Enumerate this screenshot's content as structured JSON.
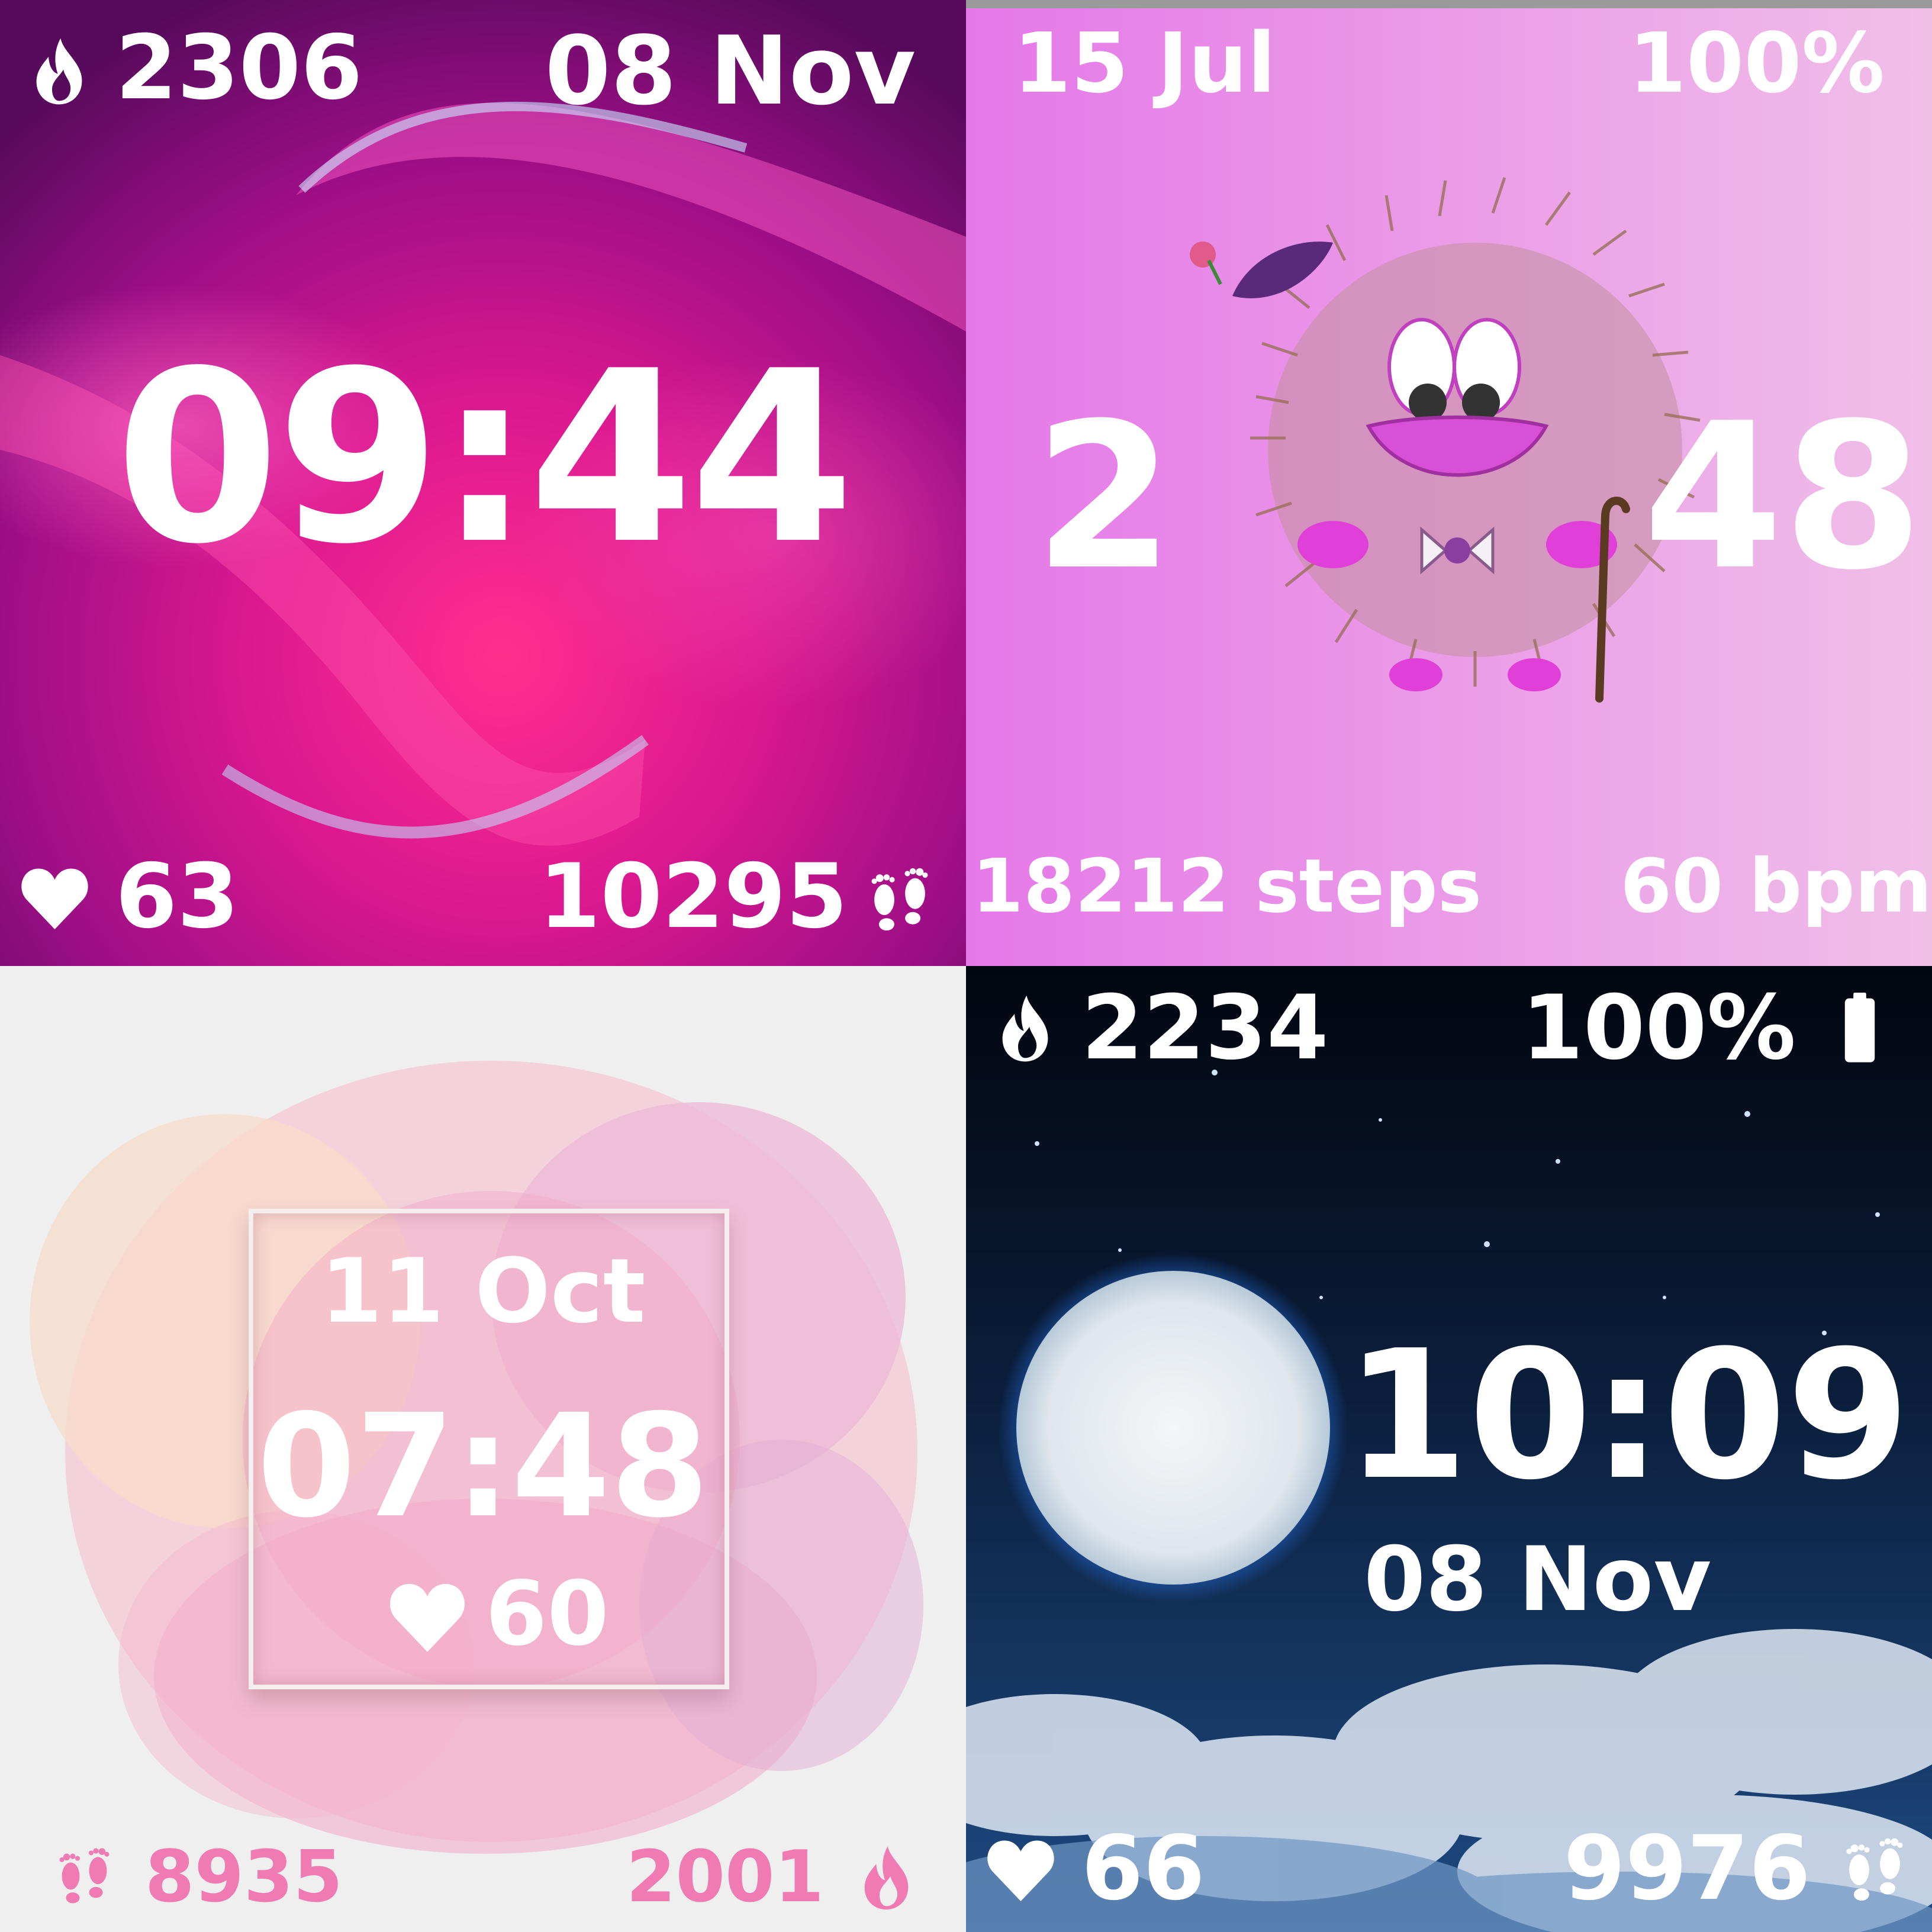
{
  "faces": [
    {
      "calories": "2306",
      "date": "08 Nov",
      "time": "09:44",
      "heart_rate": "63",
      "steps": "10295",
      "icons": [
        "flame-icon",
        "heart-icon",
        "footprints-icon"
      ],
      "colors": {
        "accent": "#e0158a",
        "background": "#6b0c66"
      }
    },
    {
      "date": "15 Jul",
      "battery": "100%",
      "hour": "2",
      "minutes": "48",
      "steps": "18212 steps",
      "heart_rate": "60 bpm",
      "colors": {
        "background": "#e98fe6"
      }
    },
    {
      "date": "11 Oct",
      "time": "07:48",
      "heart_rate": "60",
      "steps": "8935",
      "calories": "2001",
      "icons": [
        "heart-icon",
        "footprints-icon",
        "flame-icon"
      ],
      "colors": {
        "accent": "#f07ab2",
        "background": "#efefef"
      }
    },
    {
      "calories": "2234",
      "battery": "100%",
      "time": "10:09",
      "date": "08 Nov",
      "heart_rate": "66",
      "steps": "9976",
      "icons": [
        "flame-icon",
        "battery-icon",
        "heart-icon",
        "footprints-icon"
      ],
      "colors": {
        "background": "#0a1530",
        "accent": "#1e6fd6"
      }
    }
  ]
}
